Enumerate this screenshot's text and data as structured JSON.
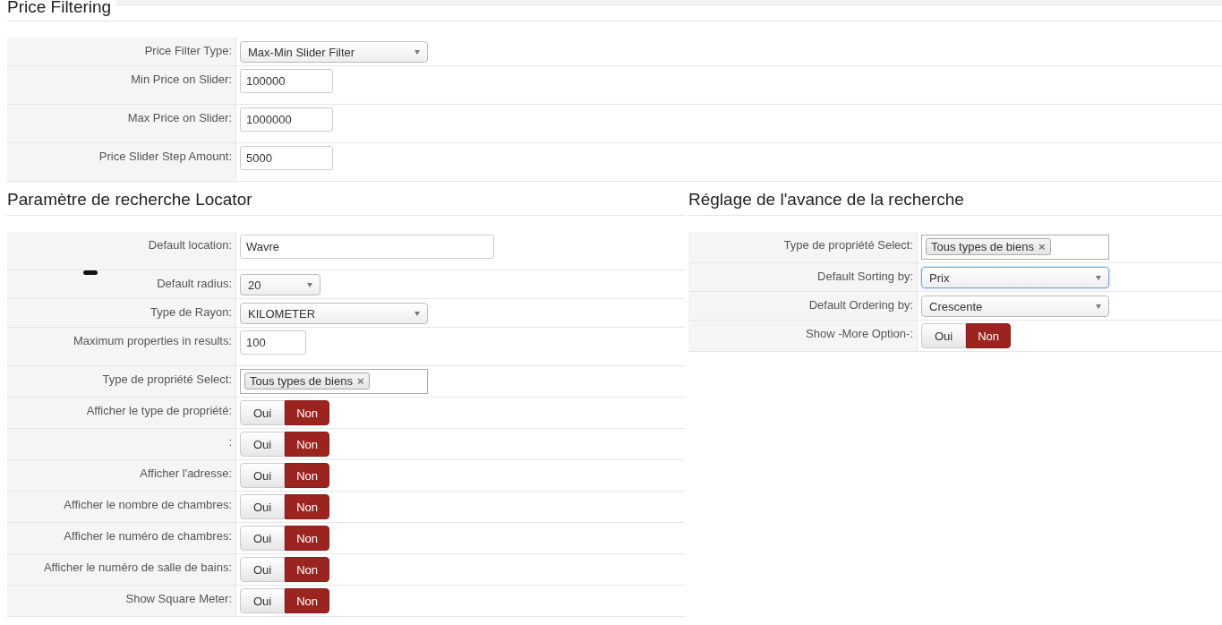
{
  "sections": [
    {
      "title": "Price Filtering",
      "rows": [
        {
          "label": "Price Filter Type:",
          "kind": "select",
          "value": "Max-Min Slider Filter"
        },
        {
          "label": "Min Price on Slider:",
          "kind": "text",
          "value": "100000"
        },
        {
          "label": "Max Price on Slider:",
          "kind": "text",
          "value": "1000000"
        },
        {
          "label": "Price Slider Step Amount:",
          "kind": "text",
          "value": "5000"
        }
      ]
    },
    {
      "title": "Paramètre de recherche Locator",
      "rows": [
        {
          "label": "Default location:",
          "kind": "text",
          "value": "Wavre"
        },
        {
          "label": "Default radius:",
          "kind": "select",
          "value": "20"
        },
        {
          "label": "Type de Rayon:",
          "kind": "select",
          "value": "KILOMETER"
        },
        {
          "label": "Maximum properties in results:",
          "kind": "text",
          "value": "100"
        },
        {
          "label": "Type de propriété Select:",
          "kind": "tags",
          "tags": [
            "Tous types de biens"
          ],
          "remove": "×"
        },
        {
          "label": "Afficher le type de propriété:",
          "kind": "toggle",
          "options": [
            {
              "label": "Oui",
              "selected": false
            },
            {
              "label": "Non",
              "selected": true
            }
          ]
        },
        {
          "label": ":",
          "kind": "toggle",
          "options": [
            {
              "label": "Oui",
              "selected": false
            },
            {
              "label": "Non",
              "selected": true
            }
          ]
        },
        {
          "label": "Afficher l'adresse:",
          "kind": "toggle",
          "options": [
            {
              "label": "Oui",
              "selected": false
            },
            {
              "label": "Non",
              "selected": true
            }
          ]
        },
        {
          "label": "Afficher le nombre de chambres:",
          "kind": "toggle",
          "options": [
            {
              "label": "Oui",
              "selected": false
            },
            {
              "label": "Non",
              "selected": true
            }
          ]
        },
        {
          "label": "Afficher le numéro de chambres:",
          "kind": "toggle",
          "options": [
            {
              "label": "Oui",
              "selected": false
            },
            {
              "label": "Non",
              "selected": true
            }
          ]
        },
        {
          "label": "Afficher le numéro de salle de bains:",
          "kind": "toggle",
          "options": [
            {
              "label": "Oui",
              "selected": false
            },
            {
              "label": "Non",
              "selected": true
            }
          ]
        },
        {
          "label": "Show Square Meter:",
          "kind": "toggle",
          "options": [
            {
              "label": "Oui",
              "selected": false
            },
            {
              "label": "Non",
              "selected": true
            }
          ]
        }
      ]
    },
    {
      "title": "Réglage de l'avance de la recherche",
      "rows": [
        {
          "label": "Type de propriété Select:",
          "kind": "tags",
          "tags": [
            "Tous types de biens"
          ],
          "remove": "×"
        },
        {
          "label": "Default Sorting by:",
          "kind": "select",
          "value": "Prix",
          "focused": true
        },
        {
          "label": "Default Ordering by:",
          "kind": "select",
          "value": "Crescente",
          "focused": false
        },
        {
          "label": "Show -More Option-:",
          "kind": "toggle",
          "options": [
            {
              "label": "Oui",
              "selected": false
            },
            {
              "label": "Non",
              "selected": true
            }
          ]
        }
      ]
    }
  ]
}
